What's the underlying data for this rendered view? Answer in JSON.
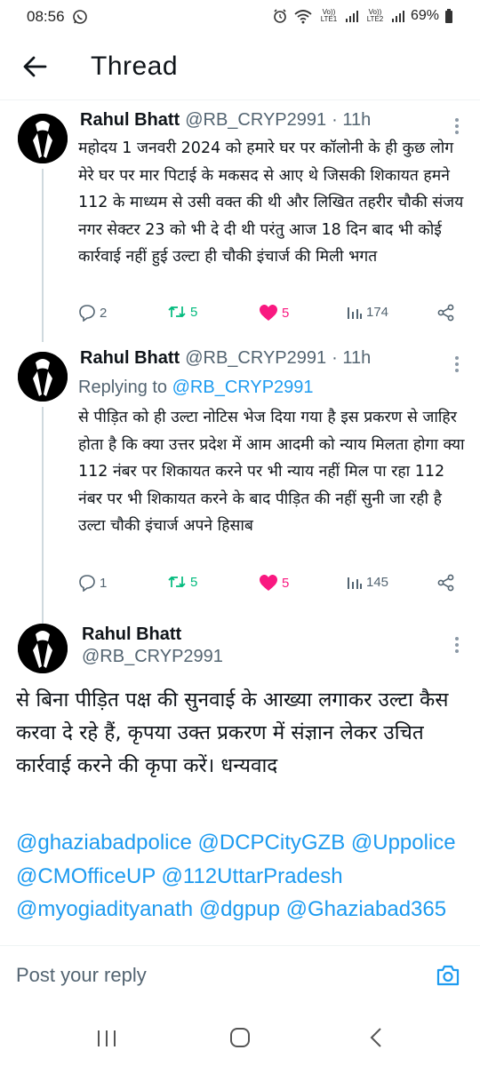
{
  "status": {
    "time": "08:56",
    "battery": "69%",
    "sim1": "Vo)) LTE1",
    "sim2": "Vo)) LTE2"
  },
  "header": {
    "title": "Thread"
  },
  "tweets": [
    {
      "name": "Rahul Bhatt",
      "handle": "@RB_CRYP2991",
      "time": "· 11h",
      "text": "महोदय 1 जनवरी 2024 को हमारे घर पर कॉलोनी के ही कुछ लोग मेरे घर पर मार पिटाई के मकसद से आए थे जिसकी शिकायत हमने 112 के माध्यम से  उसी वक्त की थी और लिखित तहरीर चौकी संजय नगर सेक्टर 23 को भी दे दी थी परंतु आज 18 दिन बाद भी कोई कार्रवाई नहीं हुई उल्टा ही  चौकी इंचार्ज की मिली भगत",
      "replies": "2",
      "retweets": "5",
      "likes": "5",
      "views": "174"
    },
    {
      "name": "Rahul Bhatt",
      "handle": "@RB_CRYP2991",
      "time": "· 11h",
      "replying_prefix": "Replying to ",
      "replying_to": "@RB_CRYP2991",
      "text": "से  पीड़ित  को ही उल्टा नोटिस भेज दिया गया है इस प्रकरण से जाहिर होता है कि क्या उत्तर प्रदेश में आम आदमी को न्याय मिलता होगा क्या 112 नंबर पर शिकायत करने पर भी न्याय नहीं मिल पा रहा 112 नंबर पर भी शिकायत करने के बाद पीड़ित की नहीं सुनी जा रही है उल्टा चौकी इंचार्ज अपने हिसाब",
      "replies": "1",
      "retweets": "5",
      "likes": "5",
      "views": "145"
    },
    {
      "name": "Rahul Bhatt",
      "handle": "@RB_CRYP2991",
      "text": "से बिना पीड़ित पक्ष की सुनवाई  के  आख्या  लगाकर उल्टा कैस करवा दे रहे हैं, कृपया उक्त प्रकरण में संज्ञान लेकर उचित कार्रवाई करने की कृपा करें। धन्यवाद",
      "mentions": [
        "@ghaziabadpolice",
        "@DCPCityGZB",
        "@Uppolice",
        "@CMOfficeUP",
        "@112UttarPradesh",
        "@myogiadityanath",
        "@dgpup",
        "@Ghaziabad365"
      ]
    }
  ],
  "reply_bar": {
    "placeholder": "Post your reply"
  },
  "icons": {
    "back": "arrow-left-icon",
    "more": "more-vertical-icon",
    "camera": "camera-icon",
    "reply": "comment-icon",
    "retweet": "retweet-icon",
    "like": "heart-icon",
    "views": "bar-chart-icon",
    "share": "share-icon"
  },
  "colors": {
    "accent": "#1d9bf0",
    "retweet": "#00ba7c",
    "like": "#f91880",
    "muted": "#536471"
  }
}
